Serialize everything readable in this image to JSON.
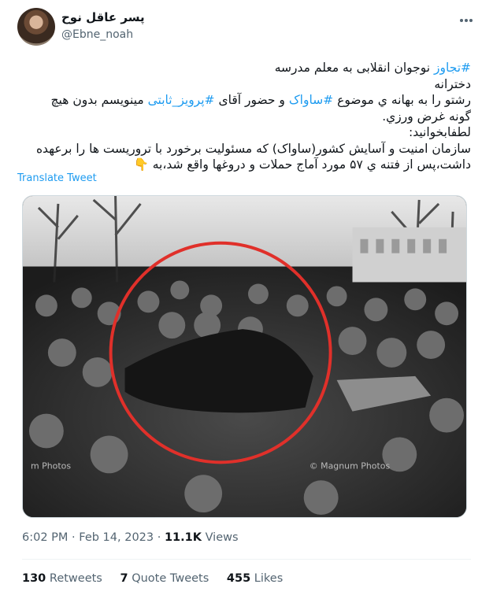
{
  "author": {
    "display_name": "پسر عاقل نوح",
    "handle": "@Ebne_noah"
  },
  "tweet": {
    "lines": [
      {
        "hashtag": "#تجاوز",
        "text": " نوجوان انقلابی به معلم مدرسه"
      },
      {
        "text": "دخترانه"
      },
      {
        "pre": "رشتو را به بهانه ي موضوع ",
        "hashtag1": "#ساواک",
        "mid": " و حضور آقای ",
        "hashtag2": "#پرویز_ثابتی",
        "post": " مینویسم بدون هیچ"
      },
      {
        "text": "گونه غرض ورزي."
      },
      {
        "text": "لطفابخوانید:"
      },
      {
        "text": "سازمان امنیت و آسایش کشور(ساواک) که مسئولیت برخورد با تروریست ها را برعهده"
      },
      {
        "text": "داشت،پس از فتنه ي ۵۷ مورد آماج حملات و دروغها واقع شد،به 👇"
      }
    ],
    "translate_label": "Translate Tweet"
  },
  "photo": {
    "watermark_left": "m Photos",
    "watermark_right": "© Magnum Photos",
    "circle_color": "#e0302a"
  },
  "meta": {
    "time": "6:02 PM",
    "date": "Feb 14, 2023",
    "views_count": "11.1K",
    "views_label": "Views"
  },
  "stats": {
    "retweets_count": "130",
    "retweets_label": "Retweets",
    "quotes_count": "7",
    "quotes_label": "Quote Tweets",
    "likes_count": "455",
    "likes_label": "Likes"
  },
  "icons": {
    "more": "more-dots-icon"
  }
}
